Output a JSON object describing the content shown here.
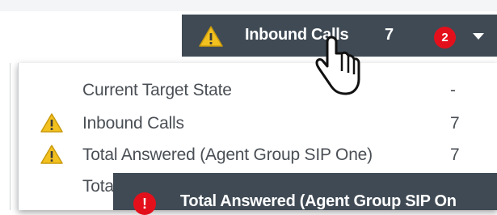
{
  "underlay": {
    "top_text": "                                                                                                        "
  },
  "header": {
    "stat_label": "Inbound Calls",
    "stat_value": "7",
    "alert_count": "2",
    "warning_icon": "warning-icon",
    "menu_icon": "caret-down-icon"
  },
  "dropdown": {
    "items": [
      {
        "label": "Current Target State",
        "value": "-",
        "icon": ""
      },
      {
        "label": "Inbound Calls",
        "value": "7",
        "icon": "warning-icon"
      },
      {
        "label": "Total Answered (Agent Group SIP One)",
        "value": "7",
        "icon": "warning-icon"
      },
      {
        "label": "Tota",
        "value": "",
        "icon": ""
      }
    ]
  },
  "toast": {
    "icon": "error-icon",
    "icon_glyph": "!",
    "text": "Total Answered (Agent Group SIP On"
  },
  "colors": {
    "bar": "#3f4a54",
    "alert": "#e3101c",
    "warning_fill": "#f3c11f",
    "text": "#4a4f55"
  }
}
